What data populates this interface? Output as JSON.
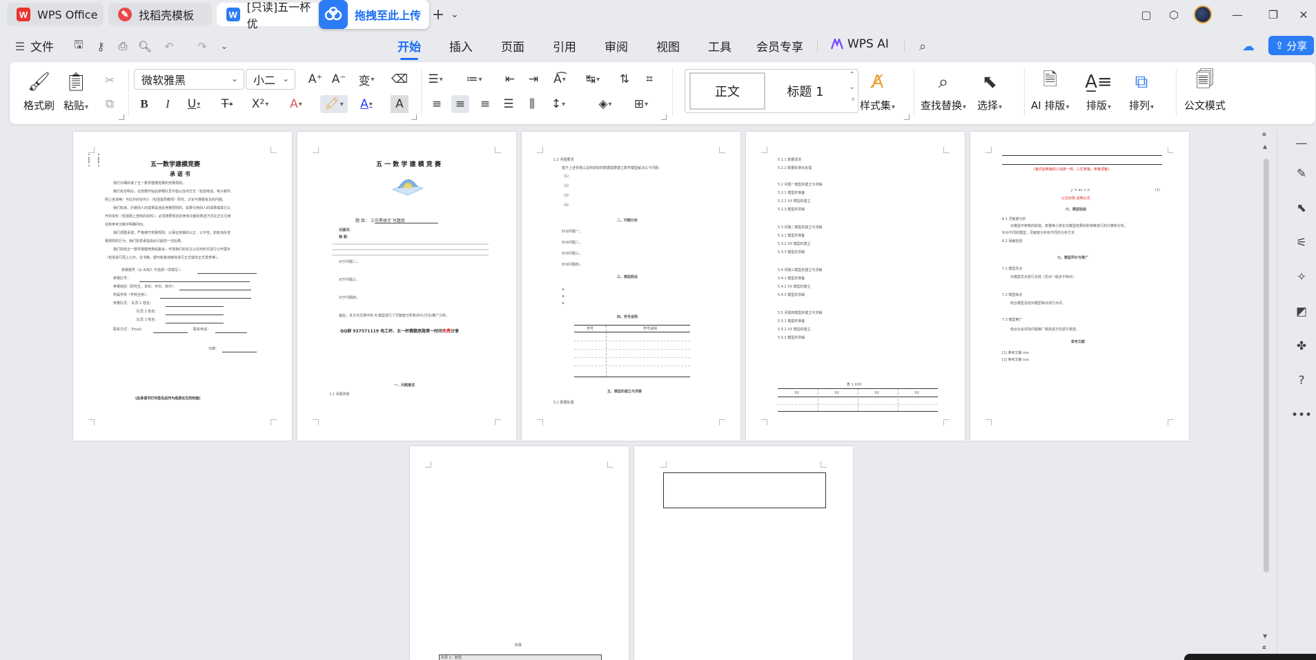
{
  "titlebar": {
    "tabs": [
      {
        "label": "WPS Office"
      },
      {
        "label": "找稻壳模板"
      },
      {
        "label": "[只读]五一杯优"
      }
    ],
    "upload_label": "拖拽至此上传",
    "new_tab": "+",
    "tab_list": "⌄"
  },
  "menu": {
    "file_label": "文件",
    "tabs": [
      "开始",
      "插入",
      "页面",
      "引用",
      "审阅",
      "视图",
      "工具",
      "会员专享"
    ],
    "ai_label": "WPS AI",
    "share_label": "分享"
  },
  "ribbon": {
    "format_painter": "格式刷",
    "paste": "粘贴",
    "font_name": "微软雅黑",
    "font_size": "小二",
    "style_normal": "正文",
    "style_heading": "标题 1",
    "style_set": "样式集",
    "find_replace": "查找替换",
    "select": "选择",
    "ai_layout": "AI 排版",
    "layout": "排版",
    "arrange": "排列",
    "official_mode": "公文模式"
  },
  "pages": {
    "p1": {
      "title": "五一数学建模竞赛",
      "subtitle": "承 诺 书",
      "footer": "(此承诺书打印签名后作为纸质论文的封面)",
      "date_label": "日期：",
      "lines": [
        "我们仔细阅读了五一数学建模竞赛的竞赛规则。",
        "我们完全明白，在竞赛开始后参赛队员不能以任何方式（包括电话、电子邮件、",
        "网上咨询等）与队外的任何人（包括指导教师）研究、讨论与赛题有关的问题。",
        "我们知道，抄袭别人的成果是违反竞赛规则的，如果引用别人的成果或其它公",
        "开的资料（包括网上查到的资料），必须按照规定的参考文献的表述方式在正文引用",
        "处和参考文献中明确列出。",
        "我们郑重承诺，严格遵守竞赛规则，以保证竞赛的公正、公平性。如有违反竞",
        "赛规则的行为，我们愿意承担由此引起的一切后果。",
        "我们授权五一数学建模竞赛组委会，可将我们的论文以任何形式进行公开展示",
        "（包括进行网上公示，在书籍、期刊和其他媒体进行正式或非正式发表等）。"
      ],
      "fields": [
        "参赛题号（从 A/B/C 中选择一项填写）：",
        "参赛队号：",
        "参赛组别（研究生、本科、专科、高中）：",
        "所属学校（学校全称）：",
        "参赛队员：  队员 1 姓名：",
        "队员 2 姓名：",
        "队员 3 姓名：",
        "联系方式：  Email：",
        "联系电话："
      ]
    },
    "p2": {
      "title": "五 一 数 学 建 模 竞 赛",
      "topic": "题 目：    三号黑体字 写题目",
      "keywords": "关键词：",
      "abstract": "摘  要：",
      "q1": "对于问题一，",
      "q2": "对于问题二，",
      "q3": "对于问题三，",
      "q4": "对于问题四，",
      "conclusion": "最后，本文对文章中的 N 模型进行了灵敏度分析和评价/讨论/推广分析。",
      "qq_prefix": "QQ群  937571119 电工杯、五一杯赛题思路第一时间",
      "qq_red": "免费",
      "qq_suffix": "分享",
      "section1": "一、问题重述",
      "section1_1": "1.1 问题背景"
    },
    "p3": {
      "h1_2": "1.2 问题要求",
      "req": "基于上述背景以及所获取的数据需要建立数学模型解决以下问题：",
      "items": [
        "（1）",
        "（2）",
        "（3）",
        "（4）"
      ],
      "section2": "二、问题分析",
      "analysis": [
        "针对问题一，",
        "针对问题二，",
        "针对问题三，",
        "针对问题四，"
      ],
      "section3": "三、模型假设",
      "section4": "四、符号说明",
      "table_h1": "符号",
      "table_h2": "符号说明",
      "section5": "五、模型的建立与求解",
      "s5_1": "5.1 数据处理"
    },
    "p4": {
      "lines": [
        "5.1.1 数据清洗",
        "5.1.2 数据标准化处理",
        "5.2 问题一模型的建立与求解",
        "5.2.1 模型的准备",
        "5.2.2 XX 模型的建立",
        "5.2.3 模型的求解",
        "5.3 问题二模型的建立与求解",
        "5.3.1 模型的准备",
        "5.3.2 XX 模型的建立",
        "5.3.3 模型的求解",
        "5.4 问题三模型的建立与求解",
        "5.4.1 模型的准备",
        "5.4.2 XX 模型的建立",
        "5.4.3 模型的求解",
        "5.5 问题四模型的建立与求解",
        "5.5.1 模型的准备",
        "5.5.2 XX 模型的建立",
        "5.5.3 模型的求解"
      ],
      "table_caption": "表 1 XXX",
      "table_headers": [
        "XX",
        "XX",
        "XX",
        "XX"
      ]
    },
    "p5": {
      "red_note": "(格式如表格的三线表一样，三栏表格，表格顶格)",
      "formula": "y = ax + b",
      "formula_no": "(1)",
      "formula_note": "公式示例 说明公式",
      "section6": "六、模型检验",
      "s6_1": "6.1 灵敏度分析",
      "s6_1_text": "对模型中参数的取值，变量微小变化对模型结果的影响等进行的计算和分析。",
      "s6_1_text2": "针对不同的模型，灵敏度分析有不同的分析方法",
      "s6_2": "6.2 误差检验",
      "section7": "七、模型评价与推广",
      "s7_1": "7.1 模型优点",
      "s7_1_t": "对模型优点进行总结（优点一般多于缺点）",
      "s7_2": "7.2 模型缺点",
      "s7_2_t": "结合模型总结对模型缺点进行点评。",
      "s7_3": "7.3 模型推广",
      "s7_3_t": "结合社会实际问题推广或改进方向进行阐述。",
      "refs_title": "参考文献",
      "refs": [
        "[1] 参考文献 xxx",
        "[2] 参考文献 xxx"
      ]
    },
    "p6": {
      "appendix": "附录",
      "appendix_box": "附录 1：数据"
    }
  }
}
